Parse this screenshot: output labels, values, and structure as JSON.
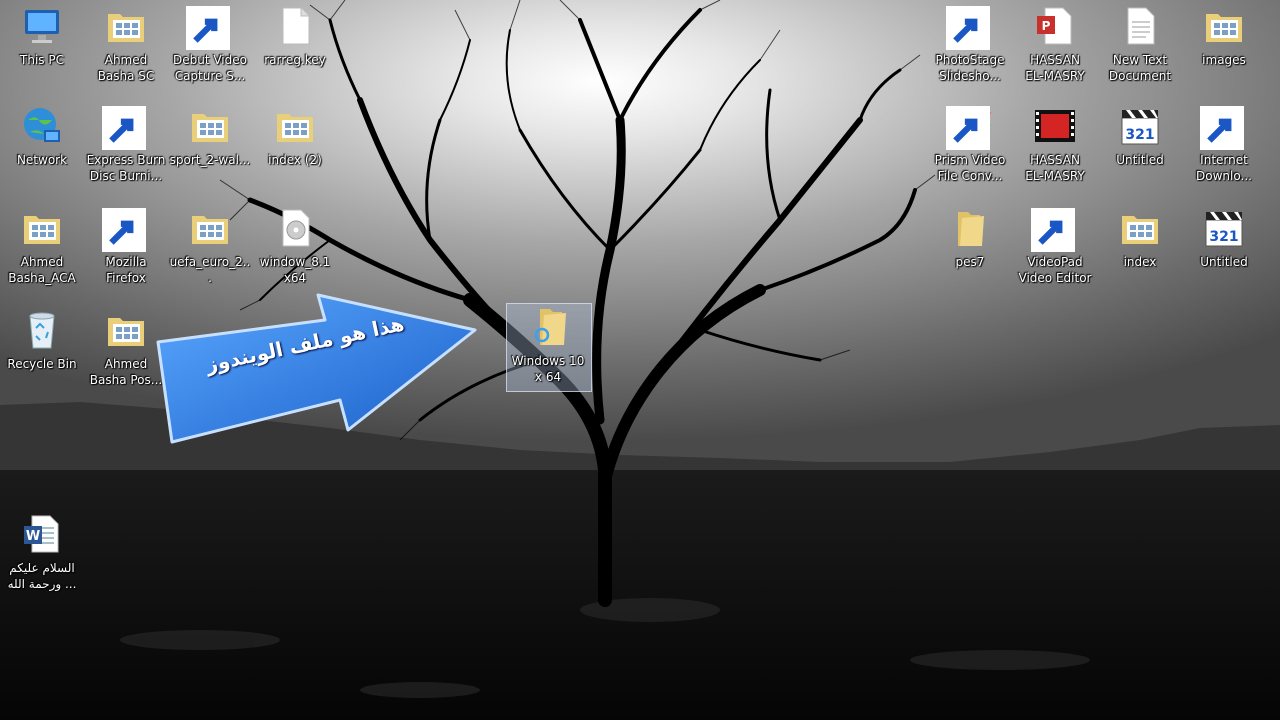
{
  "desktop": {
    "icons_left": [
      {
        "id": "this-pc",
        "label": "This PC",
        "icon": "computer-icon"
      },
      {
        "id": "ahmed-basha-sc",
        "label": "Ahmed\nBasha SC",
        "icon": "folder-icon"
      },
      {
        "id": "debut-video",
        "label": "Debut Video\nCapture S...",
        "icon": "debut-app-icon"
      },
      {
        "id": "rarreg",
        "label": "rarreg.key",
        "icon": "file-icon"
      },
      {
        "id": "network",
        "label": "Network",
        "icon": "network-icon"
      },
      {
        "id": "express-burn",
        "label": "Express Burn\nDisc Burni...",
        "icon": "express-burn-icon"
      },
      {
        "id": "sport-2",
        "label": "sport_2-wal...",
        "icon": "folder-icon"
      },
      {
        "id": "index-2",
        "label": "index (2)",
        "icon": "folder-icon"
      },
      {
        "id": "ahmed-basha-aca",
        "label": "Ahmed\nBasha_ACA",
        "icon": "folder-icon"
      },
      {
        "id": "firefox",
        "label": "Mozilla\nFirefox",
        "icon": "firefox-icon"
      },
      {
        "id": "uefa-euro",
        "label": "uefa_euro_2...",
        "icon": "folder-icon"
      },
      {
        "id": "windows-81",
        "label": "window_8.1\nx64",
        "icon": "disc-image-icon"
      },
      {
        "id": "recycle-bin",
        "label": "Recycle Bin",
        "icon": "recycle-bin-icon"
      },
      {
        "id": "ahmed-basha-pos",
        "label": "Ahmed\nBasha Pos...",
        "icon": "folder-icon"
      },
      {
        "id": "word-doc",
        "label": "السلام عليكم\nورحمة الله ...",
        "icon": "word-document-icon"
      }
    ],
    "icons_right": [
      {
        "id": "photostage",
        "label": "PhotoStage\nSlidesho...",
        "icon": "photostage-icon"
      },
      {
        "id": "hassan-pdf",
        "label": "HASSAN\nEL-MASRY",
        "icon": "pdf-icon"
      },
      {
        "id": "new-text",
        "label": "New Text\nDocument",
        "icon": "text-file-icon"
      },
      {
        "id": "images",
        "label": "images",
        "icon": "folder-icon"
      },
      {
        "id": "prism",
        "label": "Prism Video\nFile Conv...",
        "icon": "prism-icon"
      },
      {
        "id": "hassan-video",
        "label": "HASSAN\nEL-MASRY",
        "icon": "video-file-icon"
      },
      {
        "id": "untitled-1",
        "label": "Untitled",
        "icon": "clapper-321-icon"
      },
      {
        "id": "idm",
        "label": "Internet\nDownlo...",
        "icon": "idm-icon"
      },
      {
        "id": "pes7",
        "label": "pes7",
        "icon": "folder-icon"
      },
      {
        "id": "videopad",
        "label": "VideoPad\nVideo Editor",
        "icon": "videopad-icon"
      },
      {
        "id": "index",
        "label": "index",
        "icon": "folder-icon"
      },
      {
        "id": "untitled-2",
        "label": "Untitled",
        "icon": "clapper-321-icon"
      }
    ],
    "dragged_item": {
      "label": "Windows 10\nx 64",
      "icon": "folder-icon"
    },
    "callout": {
      "text": "هذا هو ملف الويندوز",
      "color": "#2f7fe0"
    }
  }
}
